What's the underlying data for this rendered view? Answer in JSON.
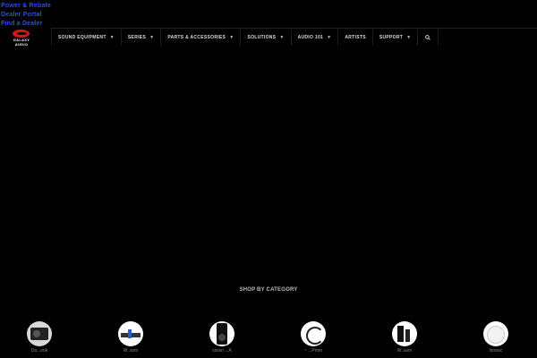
{
  "top_links": [
    "Power & Rebate",
    "Dealer Portal",
    "Find a Dealer"
  ],
  "logo": {
    "line1": "GALAXY",
    "line2": "AUDIO",
    "brand_color": "#d01818"
  },
  "nav": {
    "items": [
      {
        "label": "SOUND EQUIPMENT",
        "has_dropdown": true
      },
      {
        "label": "SERIES",
        "has_dropdown": true
      },
      {
        "label": "PARTS & ACCESSORIES",
        "has_dropdown": true
      },
      {
        "label": "SOLUTIONS",
        "has_dropdown": true
      },
      {
        "label": "AUDIO 101",
        "has_dropdown": true
      },
      {
        "label": "ARTISTS",
        "has_dropdown": false
      },
      {
        "label": "SUPPORT",
        "has_dropdown": true
      }
    ],
    "search_icon": "search-icon"
  },
  "shop_by_category": {
    "title": "SHOP BY CATEGORY",
    "categories": [
      {
        "label": "Da...ook"
      },
      {
        "label": "W..ssm"
      },
      {
        "label": "ssssn ...A"
      },
      {
        "label": "~ ...Pmm"
      },
      {
        "label": "W..ssm"
      },
      {
        "label": "lissssc"
      }
    ]
  },
  "colors": {
    "background": "#000000",
    "link": "#3344ff",
    "nav_text": "#dddddd"
  }
}
